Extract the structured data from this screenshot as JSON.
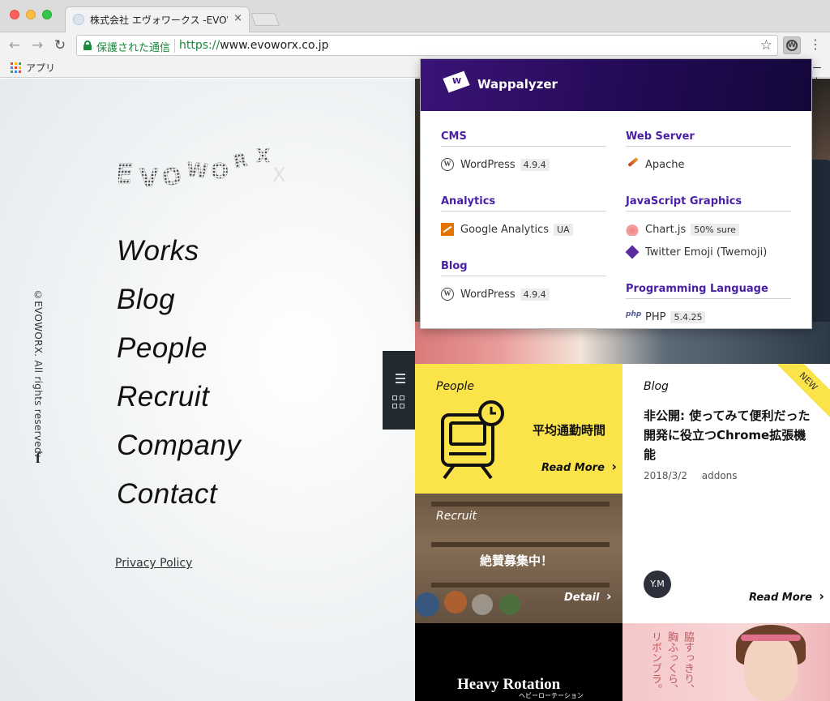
{
  "browser": {
    "tab_title": "株式会社 エヴォワークス -EVOWORX-",
    "tab_close": "×",
    "back": "←",
    "forward": "→",
    "reload": "↻",
    "secure_label": "保護された通信",
    "url_scheme": "https://",
    "url_host": "www.evoworx.co.jp",
    "bookmark_star": "☆",
    "menu": "⋮",
    "bookmarks_apps": "アプリ",
    "bookmarks_right": "ーク",
    "apps_colors": [
      "#ea4335",
      "#fbbc05",
      "#34a853",
      "#4285f4",
      "#ea4335",
      "#fbbc05",
      "#34a853",
      "#4285f4",
      "#ea4335"
    ]
  },
  "site": {
    "logo_text": "EVOWORX",
    "copyright": "©EVOWORX. All rights reserved.",
    "facebook": "f",
    "menu": [
      "Works",
      "Blog",
      "People",
      "Recruit",
      "Company",
      "Contact"
    ],
    "privacy": "Privacy Policy"
  },
  "cards": {
    "people": {
      "category": "People",
      "text": "平均通勤時間",
      "read_more": "Read More",
      "arrow": "›",
      "accent": "#fbe34a"
    },
    "blog": {
      "category": "Blog",
      "ribbon": "NEW",
      "title": "非公開: 使ってみて便利だった開発に役立つChrome拡張機能",
      "date": "2018/3/2",
      "tag": "addons",
      "avatar": "Y.M",
      "read_more": "Read More",
      "arrow": "›"
    },
    "recruit": {
      "category": "Recruit",
      "text": "絶賛募集中！",
      "detail": "Detail",
      "arrow": "›"
    },
    "heavy_rotation": {
      "title": "Heavy Rotation",
      "subtitle": "ヘビーローテーション"
    },
    "pink": {
      "copy": "脇すっきり、胸ふっくら、リボンブラ。"
    }
  },
  "wappalyzer": {
    "name": "Wappalyzer",
    "logo_letter": "W",
    "header_color": "#2a0d5e",
    "category_color": "#4a1fa6",
    "left": [
      {
        "category": "CMS",
        "apps": [
          {
            "name": "WordPress",
            "version": "4.9.4",
            "icon": "wordpress-icon"
          }
        ]
      },
      {
        "category": "Analytics",
        "apps": [
          {
            "name": "Google Analytics",
            "version": "UA",
            "icon": "google-analytics-icon"
          }
        ]
      },
      {
        "category": "Blog",
        "apps": [
          {
            "name": "WordPress",
            "version": "4.9.4",
            "icon": "wordpress-icon"
          }
        ]
      }
    ],
    "right": [
      {
        "category": "Web Server",
        "apps": [
          {
            "name": "Apache",
            "version": "",
            "icon": "apache-icon"
          }
        ]
      },
      {
        "category": "JavaScript Graphics",
        "apps": [
          {
            "name": "Chart.js",
            "version": "50% sure",
            "icon": "chartjs-icon"
          },
          {
            "name": "Twitter Emoji (Twemoji)",
            "version": "",
            "icon": "twemoji-icon"
          }
        ]
      },
      {
        "category": "Programming Language",
        "apps": [
          {
            "name": "PHP",
            "version": "5.4.25",
            "icon": "php-icon"
          }
        ]
      }
    ],
    "wp_glyph": "W",
    "php_glyph": "php"
  }
}
